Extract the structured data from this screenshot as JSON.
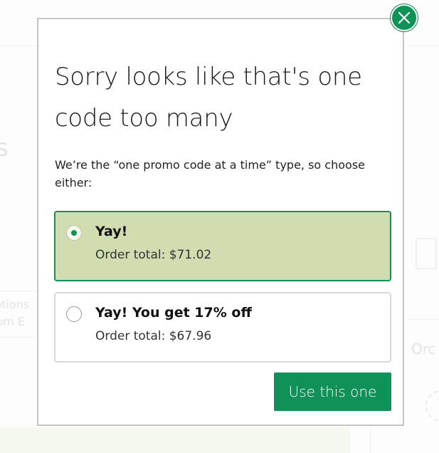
{
  "background": {
    "fragments": [
      "s",
      "ptions",
      "pm E",
      "Orc"
    ]
  },
  "modal": {
    "close_icon": "close-icon",
    "title": "Sorry looks like that's one code too many",
    "subtitle": "We’re the “one promo code at a time” type, so choose either:",
    "options": [
      {
        "label": "Yay!",
        "total": "Order total: $71.02",
        "selected": true
      },
      {
        "label": "Yay! You get 17% off",
        "total": "Order total: $67.96",
        "selected": false
      }
    ],
    "confirm_label": "Use this one"
  },
  "colors": {
    "accent": "#0f9158",
    "selected_bg": "#cfddb0",
    "modal_border": "#c6c6c6"
  }
}
